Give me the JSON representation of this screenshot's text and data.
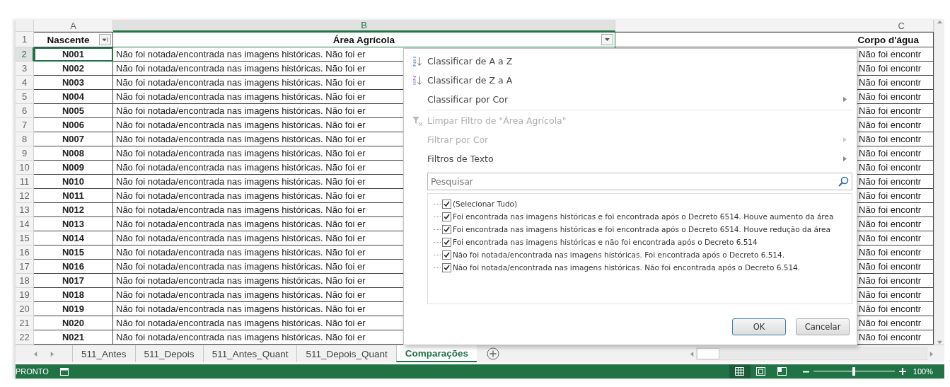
{
  "sheet": {
    "column_letters": [
      {
        "label": "A",
        "selected": false
      },
      {
        "label": "B",
        "selected": true
      },
      {
        "label": "C",
        "selected": false
      }
    ],
    "header_row": {
      "number": "1",
      "cells": [
        "Nascente",
        "Área Agrícola",
        "Corpo d'água"
      ]
    },
    "rows": [
      {
        "number": "2",
        "selected": true,
        "cells": [
          "N001",
          "Não foi notada/encontrada nas imagens históricas. Não foi er",
          "Não foi encontr"
        ]
      },
      {
        "number": "3",
        "selected": false,
        "cells": [
          "N002",
          "Não foi notada/encontrada nas imagens históricas. Não foi er",
          "Não foi encontr"
        ]
      },
      {
        "number": "4",
        "selected": false,
        "cells": [
          "N003",
          "Não foi notada/encontrada nas imagens históricas. Não foi er",
          "Não foi encontr"
        ]
      },
      {
        "number": "5",
        "selected": false,
        "cells": [
          "N004",
          "Não foi notada/encontrada nas imagens históricas. Não foi er",
          "Não foi encontr"
        ]
      },
      {
        "number": "6",
        "selected": false,
        "cells": [
          "N005",
          "Não foi notada/encontrada nas imagens históricas. Não foi er",
          "Não foi encontr"
        ]
      },
      {
        "number": "7",
        "selected": false,
        "cells": [
          "N006",
          "Não foi notada/encontrada nas imagens históricas. Não foi er",
          "Não foi encontr"
        ]
      },
      {
        "number": "8",
        "selected": false,
        "cells": [
          "N007",
          "Não foi notada/encontrada nas imagens históricas. Não foi er",
          "Não foi encontr"
        ]
      },
      {
        "number": "9",
        "selected": false,
        "cells": [
          "N008",
          "Não foi notada/encontrada nas imagens históricas. Não foi er",
          "Não foi encontr"
        ]
      },
      {
        "number": "10",
        "selected": false,
        "cells": [
          "N009",
          "Não foi notada/encontrada nas imagens históricas. Não foi er",
          "Não foi encontr"
        ]
      },
      {
        "number": "11",
        "selected": false,
        "cells": [
          "N010",
          "Não foi notada/encontrada nas imagens históricas. Não foi er",
          "Não foi encontr"
        ]
      },
      {
        "number": "12",
        "selected": false,
        "cells": [
          "N011",
          "Não foi notada/encontrada nas imagens históricas. Não foi er",
          "Não foi encontr"
        ]
      },
      {
        "number": "13",
        "selected": false,
        "cells": [
          "N012",
          "Não foi notada/encontrada nas imagens históricas. Não foi er",
          "Não foi encontr"
        ]
      },
      {
        "number": "14",
        "selected": false,
        "cells": [
          "N013",
          "Não foi notada/encontrada nas imagens históricas. Não foi er",
          "Não foi encontr"
        ]
      },
      {
        "number": "15",
        "selected": false,
        "cells": [
          "N014",
          "Não foi notada/encontrada nas imagens históricas. Não foi er",
          "Não foi encontr"
        ]
      },
      {
        "number": "16",
        "selected": false,
        "cells": [
          "N015",
          "Não foi notada/encontrada nas imagens históricas. Não foi er",
          "Não foi encontr"
        ]
      },
      {
        "number": "17",
        "selected": false,
        "cells": [
          "N016",
          "Não foi notada/encontrada nas imagens históricas. Não foi er",
          "Não foi encontr"
        ]
      },
      {
        "number": "18",
        "selected": false,
        "cells": [
          "N017",
          "Não foi notada/encontrada nas imagens históricas. Não foi er",
          "Não foi encontr"
        ]
      },
      {
        "number": "19",
        "selected": false,
        "cells": [
          "N018",
          "Não foi notada/encontrada nas imagens históricas. Não foi er",
          "Não foi encontr"
        ]
      },
      {
        "number": "20",
        "selected": false,
        "cells": [
          "N019",
          "Não foi notada/encontrada nas imagens históricas. Não foi er",
          "Não foi encontr"
        ]
      },
      {
        "number": "21",
        "selected": false,
        "cells": [
          "N020",
          "Não foi notada/encontrada nas imagens históricas. Não foi er",
          "Não foi encontr"
        ]
      },
      {
        "number": "22",
        "selected": false,
        "cells": [
          "N021",
          "Não foi notada/encontrada nas imagens históricas. Não foi er",
          "Não foi encontr"
        ]
      }
    ]
  },
  "filter_menu": {
    "items": [
      {
        "kind": "sort_az",
        "label": "Classificar de A a Z",
        "disabled": false,
        "submenu": false
      },
      {
        "kind": "sort_za",
        "label": "Classificar de Z a A",
        "disabled": false,
        "submenu": false
      },
      {
        "kind": "plain",
        "label": "Classificar por Cor",
        "disabled": false,
        "submenu": true
      },
      {
        "kind": "separator"
      },
      {
        "kind": "clear_filter",
        "label": "Limpar Filtro de \"Área Agrícola\"",
        "disabled": true,
        "submenu": false
      },
      {
        "kind": "plain",
        "label": "Filtrar por Cor",
        "disabled": true,
        "submenu": true
      },
      {
        "kind": "plain",
        "label": "Filtros de Texto",
        "disabled": false,
        "submenu": true
      }
    ],
    "search": {
      "placeholder": "Pesquisar"
    },
    "values": [
      {
        "label": "(Selecionar Tudo)",
        "checked": true
      },
      {
        "label": "Foi encontrada nas imagens históricas e  foi encontrada após o Decreto 6514. Houve aumento da área",
        "checked": true
      },
      {
        "label": "Foi encontrada nas imagens históricas e  foi encontrada após o Decreto 6514. Houve redução da área",
        "checked": true
      },
      {
        "label": "Foi encontrada nas imagens históricas e  não foi encontrada após o Decreto 6.514",
        "checked": true
      },
      {
        "label": "Não foi notada/encontrada nas imagens históricas. Foi encontrada após o Decreto 6.514.",
        "checked": true
      },
      {
        "label": "Não foi notada/encontrada nas imagens históricas. Não foi encontrada após o Decreto 6.514.",
        "checked": true
      }
    ],
    "buttons": [
      {
        "label": "OK",
        "default": true
      },
      {
        "label": "Cancelar",
        "default": false
      }
    ]
  },
  "sheet_tabs": [
    {
      "label": "511_Antes",
      "selected": false
    },
    {
      "label": "511_Depois",
      "selected": false
    },
    {
      "label": "511_Antes_Quant",
      "selected": false
    },
    {
      "label": "511_Depois_Quant",
      "selected": false
    },
    {
      "label": "Comparações",
      "selected": true
    }
  ],
  "status_bar": {
    "status": "PRONTO",
    "views": [
      {
        "kind": "normal",
        "selected": true
      },
      {
        "kind": "page_layout",
        "selected": false
      },
      {
        "kind": "page_break",
        "selected": false
      }
    ],
    "zoom": {
      "level": 0.5,
      "reading": "100%"
    }
  }
}
